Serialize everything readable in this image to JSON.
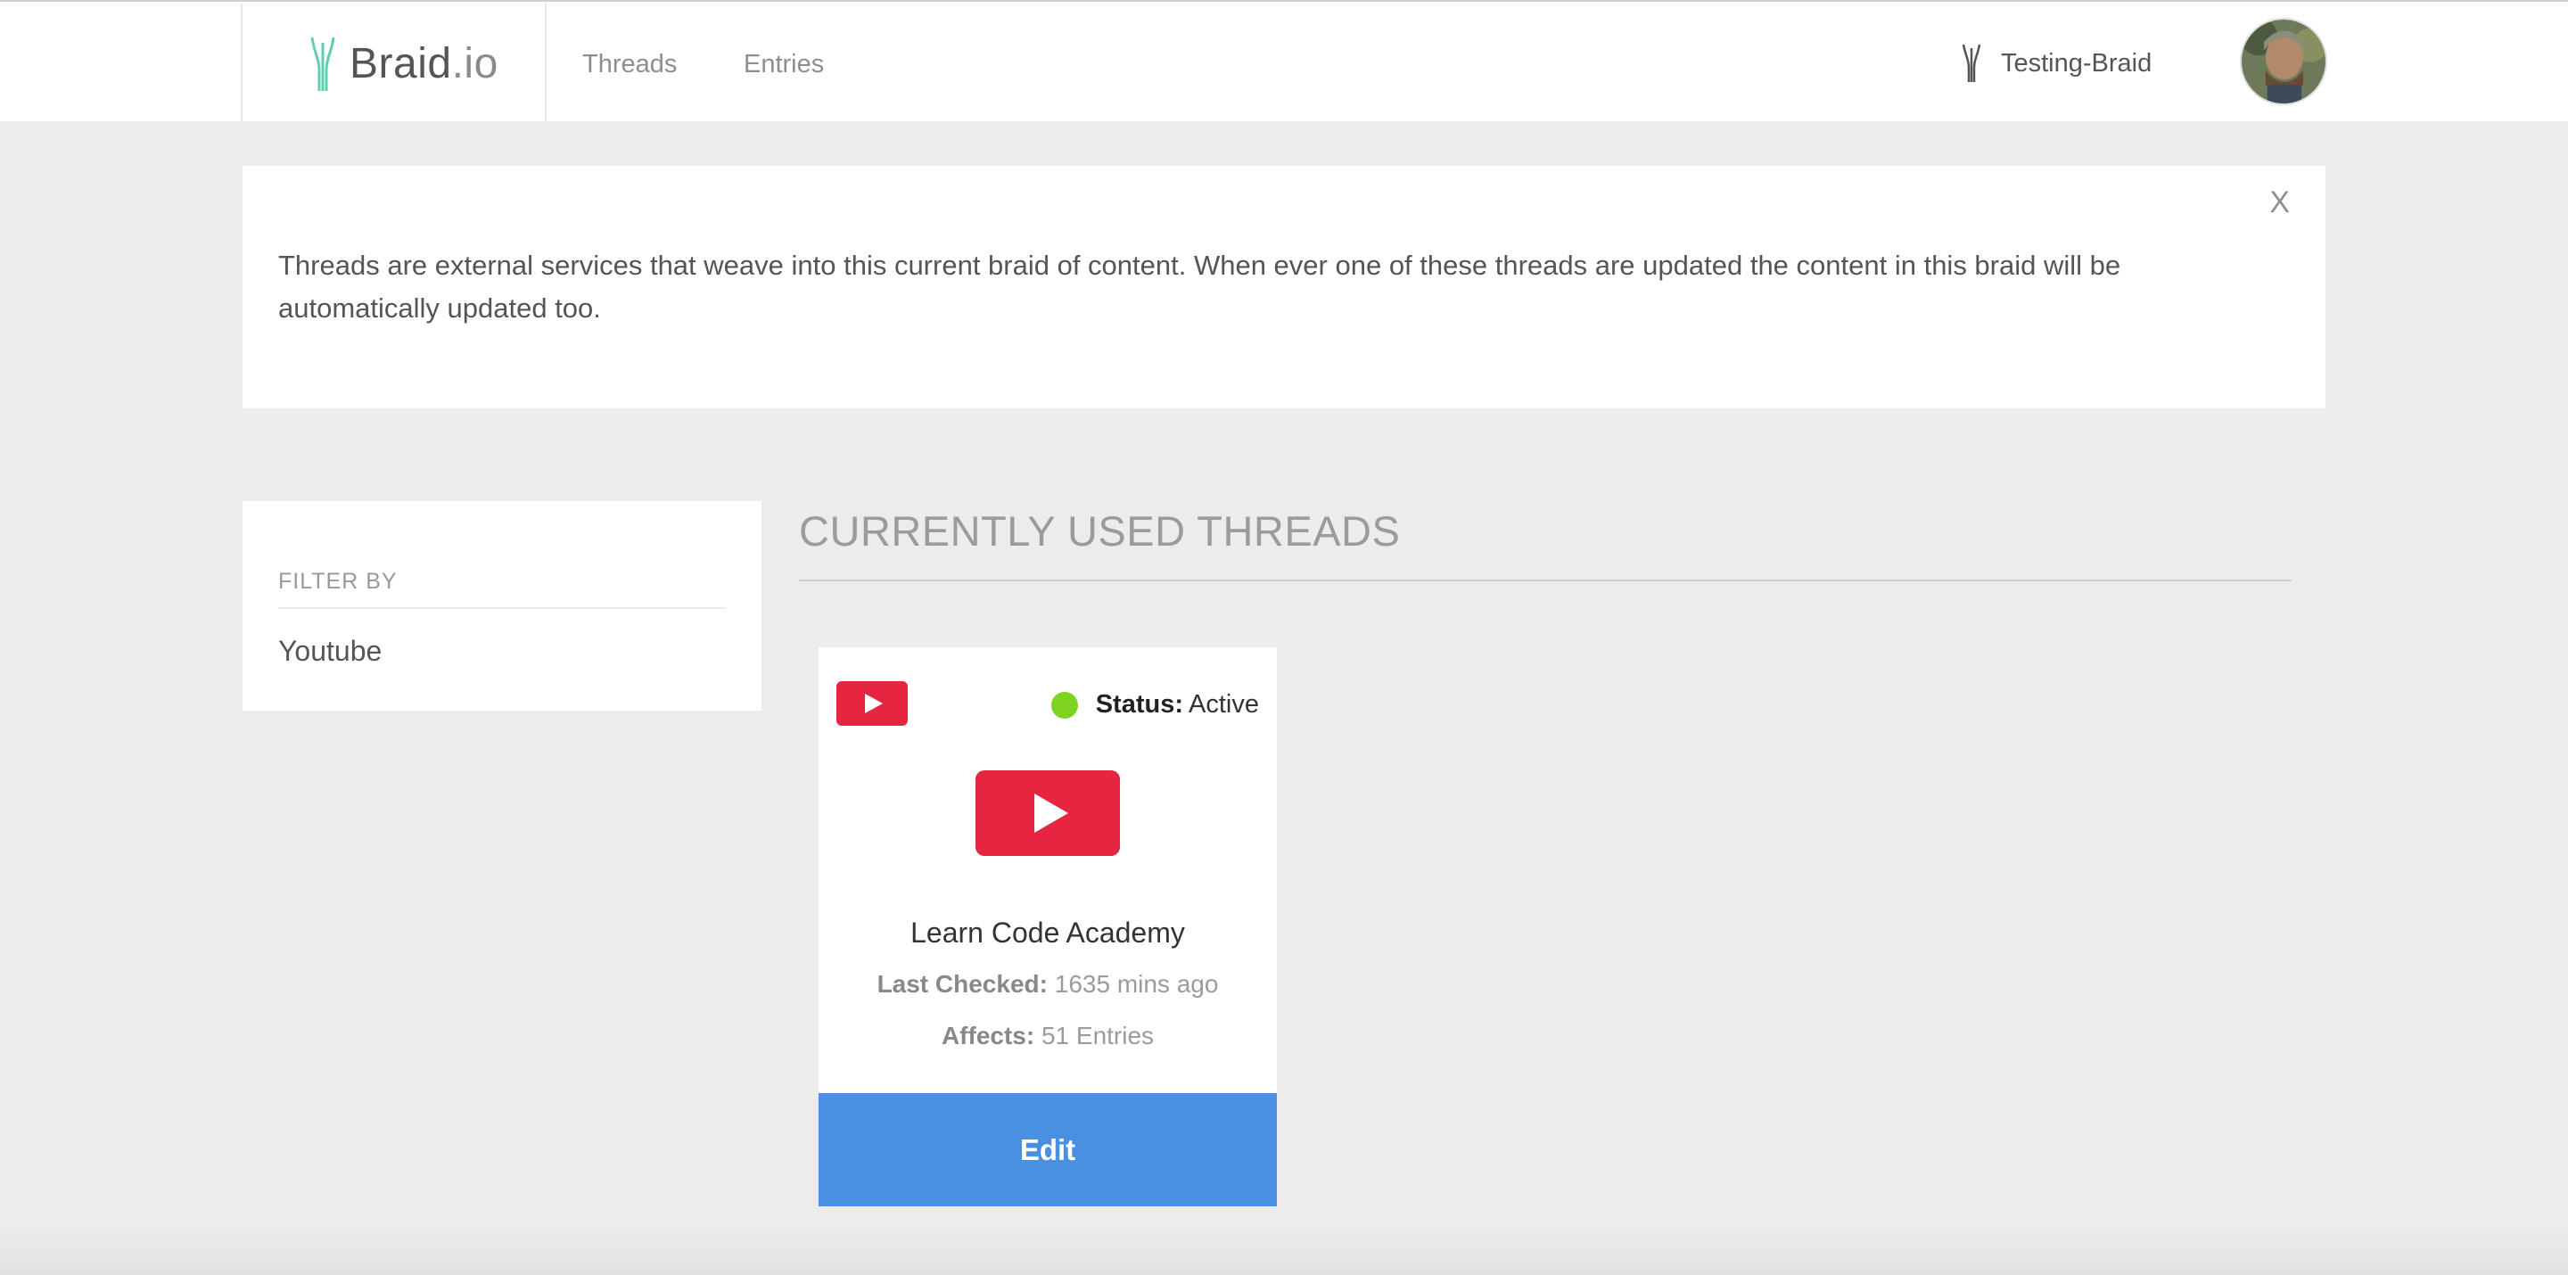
{
  "header": {
    "brand": {
      "name": "Braid",
      "tld": ".io"
    },
    "nav": [
      {
        "label": "Threads"
      },
      {
        "label": "Entries"
      }
    ],
    "current_braid": "Testing-Braid"
  },
  "notice": {
    "text": "Threads are external services that weave into this current braid of content. When ever one of these threads are updated the content in this braid will be automatically updated too.",
    "close_label": "X"
  },
  "filter": {
    "heading": "FILTER BY",
    "items": [
      "Youtube"
    ]
  },
  "main": {
    "title": "CURRENTLY USED THREADS",
    "threads": [
      {
        "service_icon": "youtube-icon",
        "status_label": "Status:",
        "status_value": "Active",
        "status_color": "#7ed321",
        "name": "Learn Code Academy",
        "last_checked_label": "Last Checked:",
        "last_checked_value": "1635 mins ago",
        "affects_label": "Affects:",
        "affects_value": "51 Entries",
        "edit_label": "Edit"
      }
    ]
  },
  "colors": {
    "brand_green": "#5fcfb0",
    "youtube_red": "#e62640",
    "edit_blue": "#4a90e2",
    "background": "#ececec"
  }
}
